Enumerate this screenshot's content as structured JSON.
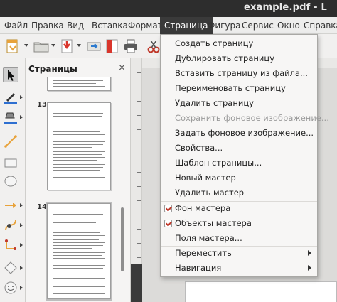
{
  "window": {
    "title": "example.pdf - L"
  },
  "menubar": {
    "items": [
      {
        "label": "Файл"
      },
      {
        "label": "Правка"
      },
      {
        "label": "Вид"
      },
      {
        "label": "Вставка"
      },
      {
        "label": "Формат"
      },
      {
        "label": "Страница"
      },
      {
        "label": "Фигура"
      },
      {
        "label": "Сервис"
      },
      {
        "label": "Окно"
      },
      {
        "label": "Справка"
      }
    ],
    "active_index": 5
  },
  "toolbar": {
    "icons": [
      "new-document-icon",
      "open-folder-icon",
      "export-pdf-icon",
      "send-icon",
      "export-directly-icon",
      "print-icon",
      "cut-icon"
    ]
  },
  "tools_sidebar": {
    "icons": [
      "select-arrow-icon",
      "line-color-icon",
      "fill-color-icon",
      "line-tool-icon",
      "rectangle-tool-icon",
      "ellipse-tool-icon",
      "line-ends-arrow-icon",
      "curve-tool-icon",
      "connector-tool-icon",
      "diamond-shape-icon",
      "smiley-shape-icon"
    ]
  },
  "pages_panel": {
    "title": "Страницы",
    "close_glyph": "×",
    "pages": [
      {
        "number": "13"
      },
      {
        "number": "14"
      }
    ]
  },
  "dropdown": {
    "items": [
      {
        "label": "Создать страницу",
        "enabled": true
      },
      {
        "label": "Дублировать страницу",
        "enabled": true
      },
      {
        "label": "Вставить страницу из файла...",
        "enabled": true
      },
      {
        "label": "Переименовать страницу",
        "enabled": true
      },
      {
        "label": "Удалить страницу",
        "enabled": true
      },
      {
        "label": "Сохранить фоновое изображение...",
        "enabled": false
      },
      {
        "label": "Задать фоновое изображение...",
        "enabled": true
      },
      {
        "label": "Свойства...",
        "enabled": true
      },
      {
        "label": "Шаблон страницы...",
        "enabled": true
      },
      {
        "label": "Новый мастер",
        "enabled": true
      },
      {
        "label": "Удалить мастер",
        "enabled": true
      },
      {
        "label": "Фон мастера",
        "enabled": true,
        "checked": true
      },
      {
        "label": "Объекты мастера",
        "enabled": true,
        "checked": true
      },
      {
        "label": "Поля мастера...",
        "enabled": true
      },
      {
        "label": "Переместить",
        "enabled": true,
        "submenu": true
      },
      {
        "label": "Навигация",
        "enabled": true,
        "submenu": true
      }
    ]
  },
  "colors": {
    "titlebar": "#2d2d2d",
    "menu_active": "#3a3a3a",
    "check_mark": "#c0392b",
    "accent_orange": "#e8a23a"
  }
}
